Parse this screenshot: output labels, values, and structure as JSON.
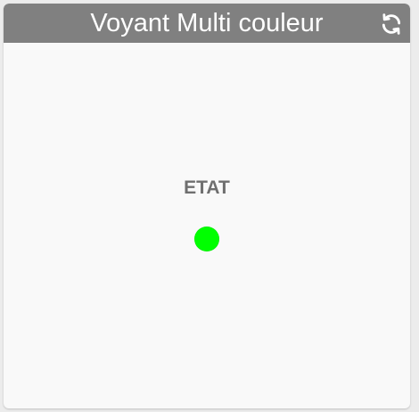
{
  "widget": {
    "title": "Voyant Multi couleur",
    "refresh_icon": "refresh-icon",
    "state_label": "ETAT",
    "indicator_color": "#00ff00",
    "header_color": "#808080"
  }
}
